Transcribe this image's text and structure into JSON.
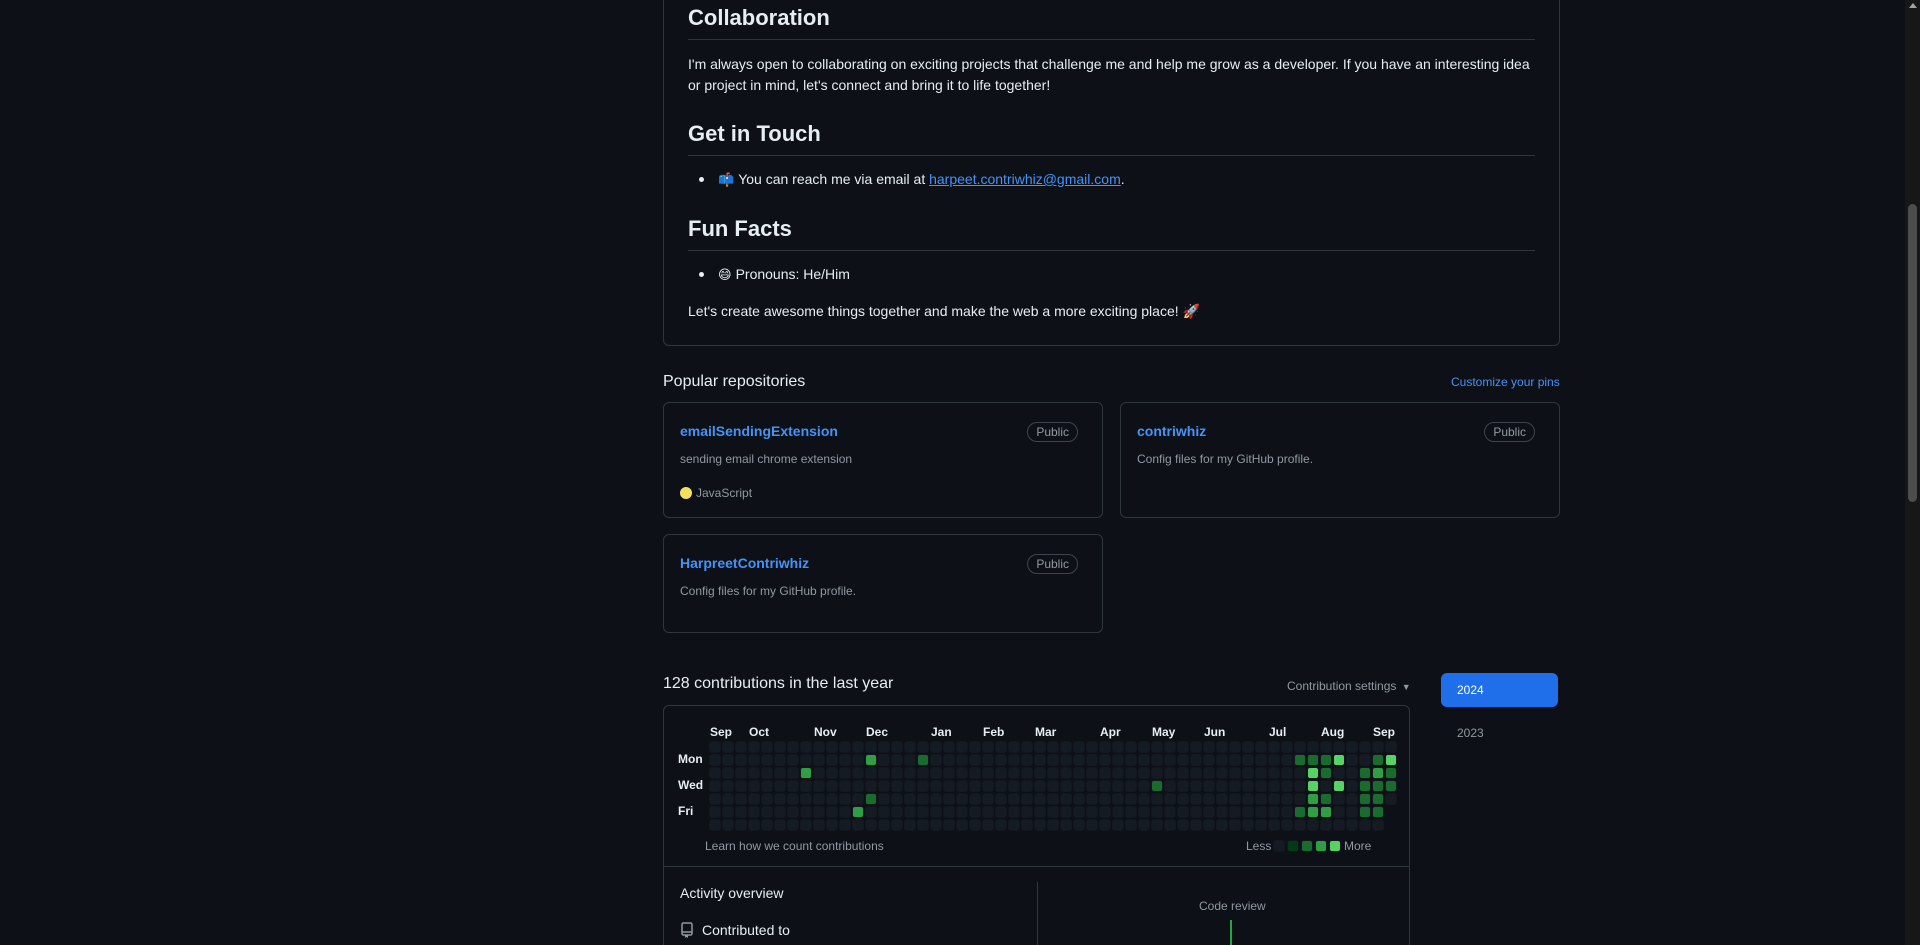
{
  "readme": {
    "collaboration_heading": "Collaboration",
    "collaboration_text": "I'm always open to collaborating on exciting projects that challenge me and help me grow as a developer. If you have an interesting idea or project in mind, let's connect and bring it to life together!",
    "contact_heading": "Get in Touch",
    "contact_prefix": "You can reach me via email at ",
    "contact_email": "harpeet.contriwhiz@gmail.com",
    "contact_suffix": ".",
    "contact_emoji": "📫",
    "fun_heading": "Fun Facts",
    "pronouns_emoji": "😄",
    "pronouns": "Pronouns: He/Him",
    "closing": "Let's create awesome things together and make the web a more exciting place! 🚀"
  },
  "pinned": {
    "title": "Popular repositories",
    "customize": "Customize your pins",
    "repos": [
      {
        "name": "emailSendingExtension",
        "visibility": "Public",
        "description": "sending email chrome extension",
        "language": "JavaScript",
        "language_color": "#f1e05a"
      },
      {
        "name": "contriwhiz",
        "visibility": "Public",
        "description": "Config files for my GitHub profile.",
        "language": "",
        "language_color": ""
      },
      {
        "name": "HarpreetContriwhiz",
        "visibility": "Public",
        "description": "Config files for my GitHub profile.",
        "language": "",
        "language_color": ""
      }
    ]
  },
  "contributions": {
    "title": "128 contributions in the last year",
    "settings": "Contribution settings",
    "years": [
      "2024",
      "2023"
    ],
    "months": [
      "Sep",
      "Oct",
      "Nov",
      "Dec",
      "Jan",
      "Feb",
      "Mar",
      "Apr",
      "May",
      "Jun",
      "Jul",
      "Aug",
      "Sep"
    ],
    "days": [
      "Mon",
      "Wed",
      "Fri"
    ],
    "learn": "Learn how we count contributions",
    "less": "Less",
    "more": "More",
    "level_colors": [
      "#151b23",
      "#033a16",
      "#196c2e",
      "#2ea043",
      "#56d364"
    ],
    "active_cells": [
      {
        "week": 7,
        "day": 2,
        "level": 3
      },
      {
        "week": 11,
        "day": 5,
        "level": 3
      },
      {
        "week": 12,
        "day": 1,
        "level": 3
      },
      {
        "week": 12,
        "day": 4,
        "level": 2
      },
      {
        "week": 16,
        "day": 1,
        "level": 2
      },
      {
        "week": 34,
        "day": 3,
        "level": 2
      },
      {
        "week": 45,
        "day": 1,
        "level": 2
      },
      {
        "week": 45,
        "day": 5,
        "level": 2
      },
      {
        "week": 46,
        "day": 1,
        "level": 2
      },
      {
        "week": 46,
        "day": 2,
        "level": 4
      },
      {
        "week": 46,
        "day": 3,
        "level": 4
      },
      {
        "week": 46,
        "day": 4,
        "level": 3
      },
      {
        "week": 46,
        "day": 5,
        "level": 3
      },
      {
        "week": 47,
        "day": 1,
        "level": 2
      },
      {
        "week": 47,
        "day": 2,
        "level": 2
      },
      {
        "week": 47,
        "day": 4,
        "level": 2
      },
      {
        "week": 47,
        "day": 5,
        "level": 3
      },
      {
        "week": 48,
        "day": 1,
        "level": 4
      },
      {
        "week": 48,
        "day": 3,
        "level": 4
      },
      {
        "week": 50,
        "day": 2,
        "level": 2
      },
      {
        "week": 50,
        "day": 3,
        "level": 2
      },
      {
        "week": 50,
        "day": 4,
        "level": 2
      },
      {
        "week": 50,
        "day": 5,
        "level": 2
      },
      {
        "week": 51,
        "day": 1,
        "level": 2
      },
      {
        "week": 51,
        "day": 2,
        "level": 3
      },
      {
        "week": 51,
        "day": 3,
        "level": 2
      },
      {
        "week": 51,
        "day": 4,
        "level": 2
      },
      {
        "week": 51,
        "day": 5,
        "level": 2
      },
      {
        "week": 52,
        "day": 1,
        "level": 4
      },
      {
        "week": 52,
        "day": 2,
        "level": 2
      },
      {
        "week": 52,
        "day": 3,
        "level": 2
      }
    ],
    "overview_title": "Activity overview",
    "contributed_to": "Contributed to",
    "code_review": "Code review"
  }
}
